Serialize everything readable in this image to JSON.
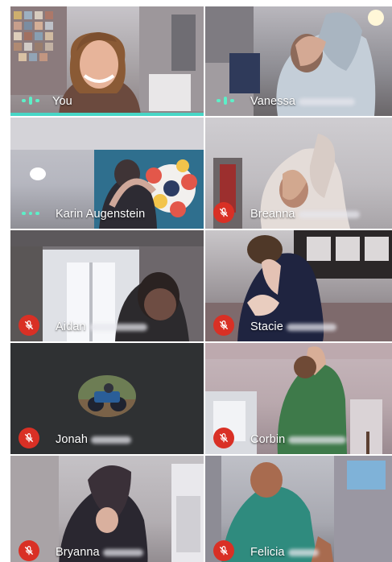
{
  "participants": [
    {
      "first": "You",
      "redacted": false,
      "mic": "speaking",
      "active": true,
      "scene": "you"
    },
    {
      "first": "Vanessa",
      "redacted": true,
      "mic": "speaking",
      "active": false,
      "scene": "vanessa"
    },
    {
      "first": "Karin Augenstein",
      "redacted": false,
      "mic": "speaking",
      "active": false,
      "scene": "karin"
    },
    {
      "first": "Breanna",
      "redacted": true,
      "mic": "muted",
      "active": false,
      "scene": "breanna"
    },
    {
      "first": "Aidan",
      "redacted": true,
      "mic": "muted",
      "active": false,
      "scene": "aidan"
    },
    {
      "first": "Stacie",
      "redacted": true,
      "mic": "muted",
      "active": false,
      "scene": "stacie"
    },
    {
      "first": "Jonah",
      "redacted": true,
      "mic": "muted",
      "active": false,
      "scene": "jonah"
    },
    {
      "first": "Corbin",
      "redacted": true,
      "mic": "muted",
      "active": false,
      "scene": "corbin"
    },
    {
      "first": "Bryanna",
      "redacted": true,
      "mic": "muted",
      "active": false,
      "scene": "bryanna"
    },
    {
      "first": "Felicia",
      "redacted": true,
      "mic": "muted",
      "active": false,
      "scene": "felicia"
    }
  ],
  "colors": {
    "muted_badge": "#d93025",
    "speaking_dots": "#5cf0c8",
    "active_speaker_bar": "#47d6c6"
  },
  "icons": {
    "muted": "mic-off-icon",
    "speaking": "audio-level-icon"
  }
}
